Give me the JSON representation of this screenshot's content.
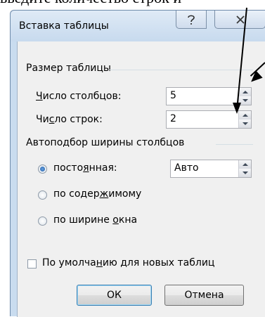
{
  "background_text": "введите количество строк и",
  "window": {
    "title": "Вставка таблицы",
    "help_icon": "question-mark-icon",
    "close_icon": "close-icon"
  },
  "size_group": {
    "label": "Размер таблицы",
    "columns_label_ul": "Ч",
    "columns_label_rest": "исло столбцов:",
    "columns_value": "5",
    "rows_label_pre": "Чи",
    "rows_label_ul": "с",
    "rows_label_rest": "ло строк:",
    "rows_value": "2"
  },
  "autofit_group": {
    "label": "Автоподбор ширины столбцов",
    "fixed_pre": "посто",
    "fixed_ul": "я",
    "fixed_rest": "нная:",
    "fixed_value": "Авто",
    "content_pre": "по содер",
    "content_ul": "ж",
    "content_rest": "имому",
    "window_pre": "по ширине ",
    "window_ul": "о",
    "window_rest": "кна",
    "selected": "fixed"
  },
  "default_check": {
    "pre": "По умолча",
    "ul": "н",
    "rest": "ию для новых таблиц",
    "checked": false
  },
  "buttons": {
    "ok": "ОК",
    "cancel": "Отмена"
  },
  "colors": {
    "frame": "#c9dcef",
    "client": "#f0f0f0",
    "radio_selected": "#1f5ca6"
  }
}
